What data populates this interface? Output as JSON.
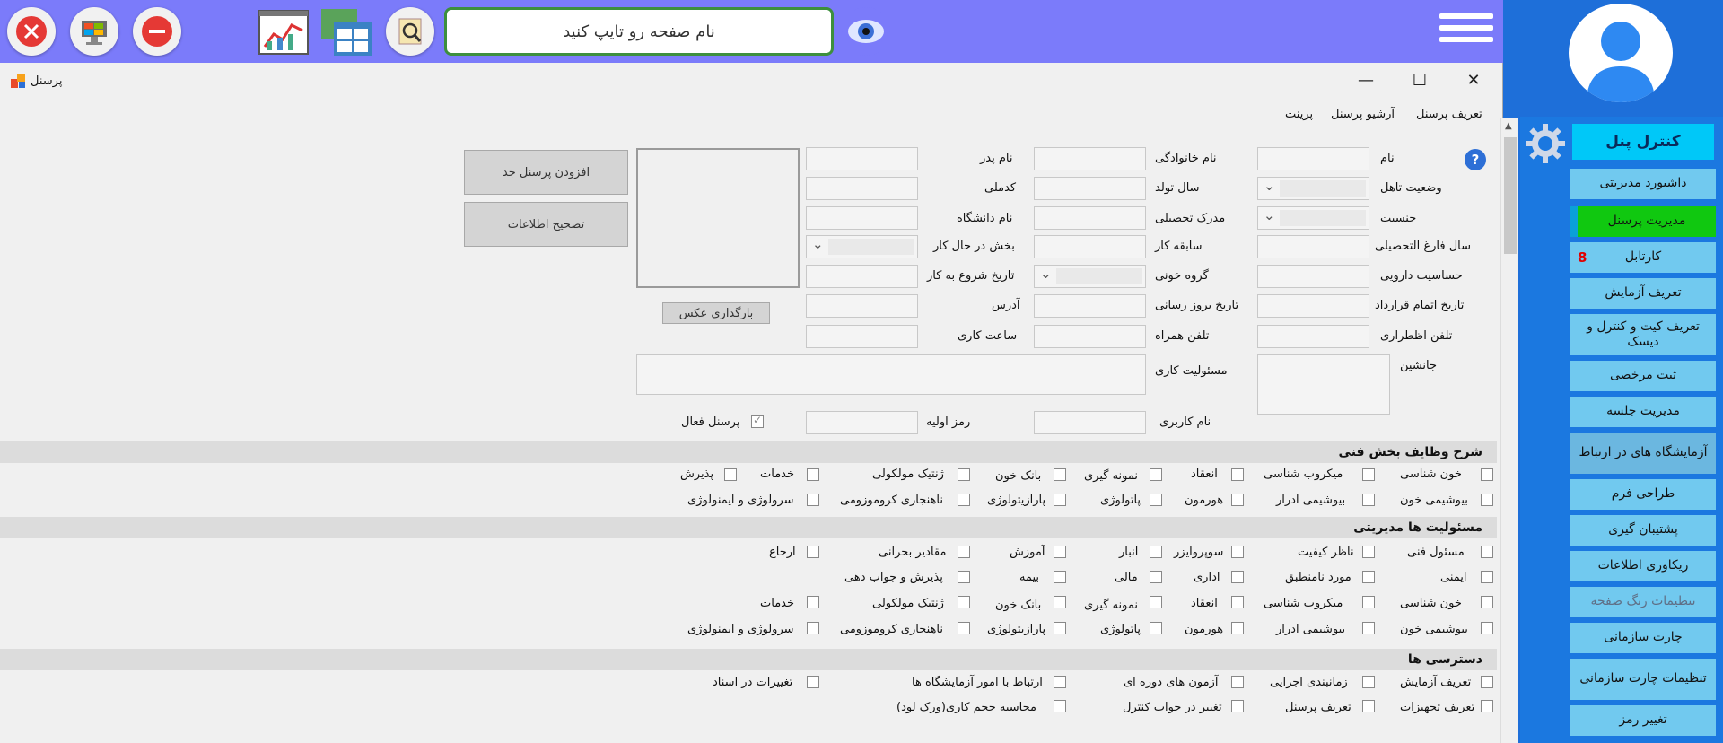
{
  "topbar": {
    "search_placeholder": "نام صفحه رو تایپ کنید"
  },
  "window": {
    "title": "پرسنل",
    "tabs": [
      "تعریف پرسنل",
      "آرشیو پرسنل",
      "پرینت"
    ]
  },
  "form": {
    "col1_labels": [
      "نام",
      "وضعیت تاهل",
      "جنسیت",
      "سال فارغ التحصیلی",
      "حساسیت دارویی",
      "تاریخ اتمام قرارداد",
      "تلفن اظطراری",
      "جانشین"
    ],
    "col2_labels": [
      "نام خانوادگی",
      "سال تولد",
      "مدرک تحصیلی",
      "سابقه کار",
      "گروه خونی",
      "تاریخ بروز رسانی",
      "تلفن همراه",
      "مسئولیت کاری"
    ],
    "col3_labels": [
      "نام پدر",
      "کدملی",
      "نام دانشگاه",
      "بخش در حال کار",
      "تاریخ شروع به کار",
      "آدرس",
      "ساعت کاری"
    ],
    "username_label": "نام کاربری",
    "password_label": "رمز اولیه",
    "active_label": "پرسنل فعال",
    "upload_photo": "بارگذاری عکس",
    "add_button": "افزودن پرسنل جد",
    "edit_button": "تصحیح اطلاعات"
  },
  "sections": {
    "tech": {
      "title": "شرح وظایف بخش فنی",
      "row1": [
        "خون شناسی",
        "میکروب شناسی",
        "انعقاد",
        "نمونه گیری",
        "بانک خون",
        "ژنتیک مولکولی",
        "خدمات",
        "پذیرش"
      ],
      "row2": [
        "بیوشیمی خون",
        "بیوشیمی ادرار",
        "هورمون",
        "پاتولوژی",
        "پارازیتولوژی",
        "ناهنجاری کروموزومی",
        "سرولوژی و ایمنولوژی"
      ]
    },
    "mgmt": {
      "title": "مسئولیت ها مدیریتی",
      "row1": [
        "مسئول فنی",
        "ناظر کیفیت",
        "سوپروایزر",
        "انبار",
        "آموزش",
        "مقادیر بحرانی",
        "ارجاع"
      ],
      "row2": [
        "ایمنی",
        "مورد نامنطبق",
        "اداری",
        "مالی",
        "بیمه",
        "پذیرش و جواب دهی"
      ],
      "row3": [
        "خون شناسی",
        "میکروب شناسی",
        "انعقاد",
        "نمونه گیری",
        "بانک خون",
        "ژنتیک مولکولی",
        "خدمات"
      ],
      "row4": [
        "بیوشیمی خون",
        "بیوشیمی ادرار",
        "هورمون",
        "پاتولوژی",
        "پارازیتولوژی",
        "ناهنجاری کروموزومی",
        "سرولوژی و ایمنولوژی"
      ]
    },
    "access": {
      "title": "دسترسی ها",
      "row1": [
        "تعریف آزمایش",
        "زمانبندی اجرایی",
        "آزمون های دوره ای",
        "ارتباط با امور آزمایشگاه ها",
        "تغییرات در اسناد"
      ],
      "row2": [
        "تعریف تجهیزات",
        "تعریف پرسنل",
        "تغییر در جواب کنترل",
        "محاسبه حجم کاری(ورک لود)"
      ]
    }
  },
  "sidebar": {
    "title": "کنترل پنل",
    "items": [
      {
        "label": "داشبورد مدیریتی"
      },
      {
        "label": "مدیریت پرسنل"
      },
      {
        "label": "کارتابل",
        "badge": "8"
      },
      {
        "label": "تعریف آزمایش"
      },
      {
        "label": "تعریف کیت و کنترل و دیسک"
      },
      {
        "label": "ثبت مرخصی"
      },
      {
        "label": "مدیریت جلسه"
      },
      {
        "label": "آزمایشگاه های در ارتباط"
      },
      {
        "label": "طراحی فرم"
      },
      {
        "label": "پشتیبان گیری"
      },
      {
        "label": "ریکاوری اطلاعات"
      },
      {
        "label": "تنظیمات رنگ صفحه"
      },
      {
        "label": "چارت سازمانی"
      },
      {
        "label": "تنظیمات چارت سازمانی"
      },
      {
        "label": "تغییر رمز"
      }
    ]
  }
}
